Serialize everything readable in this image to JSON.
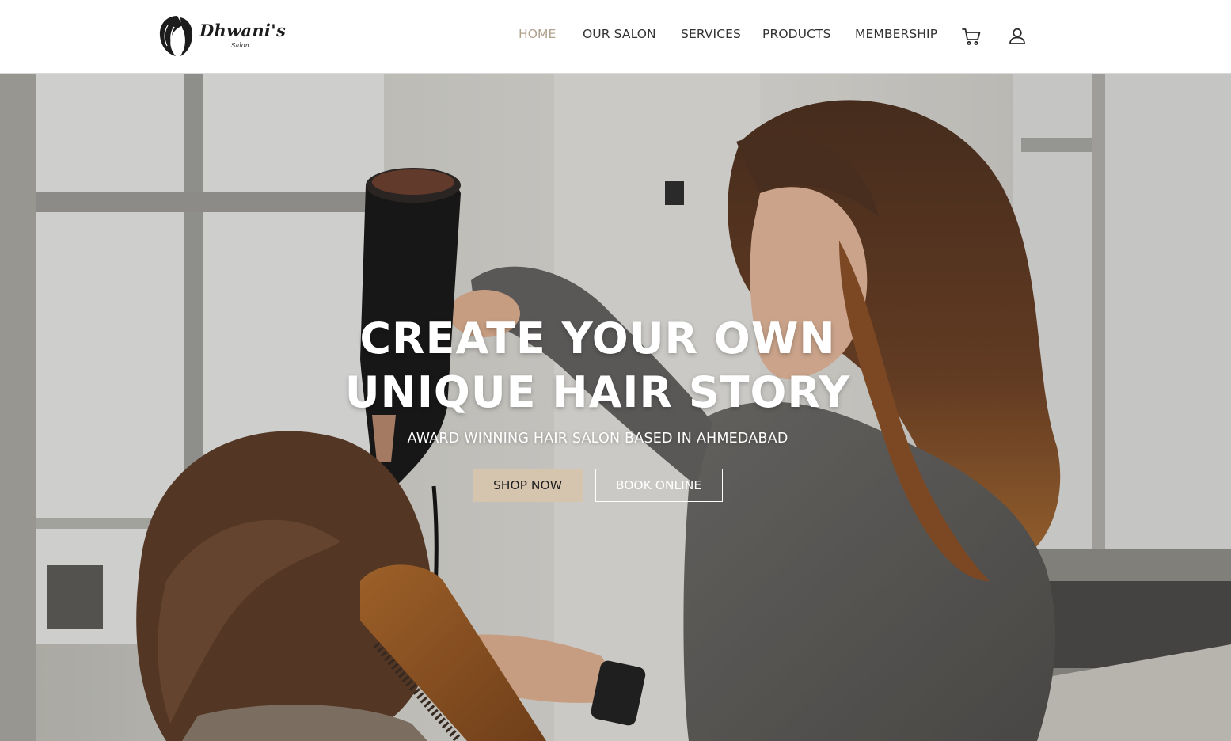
{
  "brand": {
    "name": "Dhwani's",
    "tagline": "Salon",
    "logo_icon": "hair-silhouette-icon"
  },
  "nav": {
    "items": [
      {
        "label": "HOME",
        "active": true
      },
      {
        "label": "OUR SALON",
        "active": false
      },
      {
        "label": "SERVICES",
        "active": false
      },
      {
        "label": "PRODUCTS",
        "active": false
      },
      {
        "label": "MEMBERSHIP",
        "active": false
      }
    ],
    "icons": [
      "cart-icon",
      "user-icon"
    ]
  },
  "hero": {
    "title_line1": "CREATE YOUR OWN",
    "title_line2": "UNIQUE HAIR STORY",
    "subtitle": "AWARD WINNING HAIR SALON BASED IN AHMEDABAD",
    "primary_button": "SHOP NOW",
    "secondary_button": "BOOK ONLINE"
  },
  "colors": {
    "accent": "#b0a18d",
    "button_fill": "#d5c4ae",
    "text_dark": "#333333",
    "header_bg": "#ffffff"
  }
}
